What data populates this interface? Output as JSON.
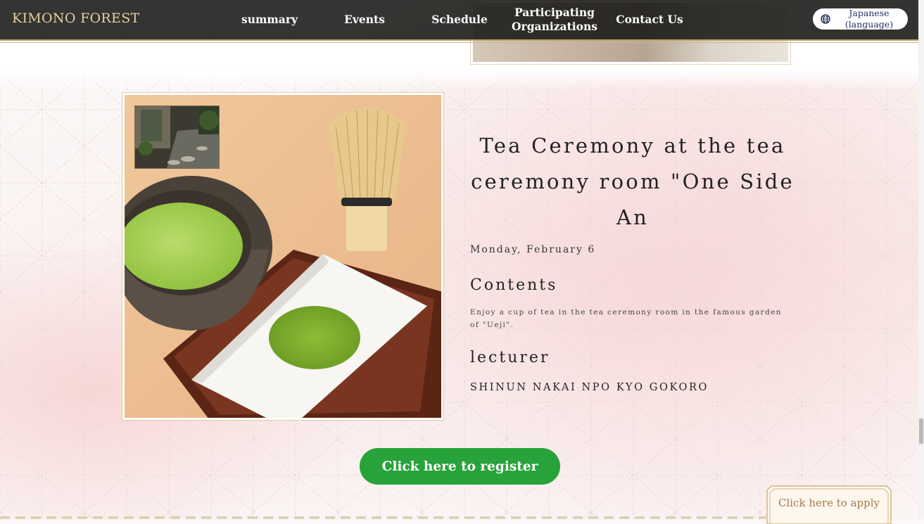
{
  "header": {
    "logo": "KIMONO FOREST",
    "nav": [
      {
        "label": "summary"
      },
      {
        "label": "Events"
      },
      {
        "label": "Schedule"
      },
      {
        "label": "Participating Organizations"
      },
      {
        "label": "Contact Us"
      }
    ],
    "language": {
      "label": "Japanese (language)",
      "icon": "globe-icon"
    }
  },
  "event": {
    "title": "Tea Ceremony at the tea ceremony room \"One Side An",
    "date": "Monday, February 6",
    "contents_heading": "Contents",
    "contents_text": "Enjoy a cup of tea in the tea ceremony room in the famous garden of \"Ueji\".",
    "lecturer_heading": "lecturer",
    "lecturer_name": "SHINUN NAKAI NPO KYO GOKORO"
  },
  "actions": {
    "register": "Click here to register",
    "apply": "Click here to apply"
  },
  "colors": {
    "navbar": "#181816",
    "logo": "#e4cfa0",
    "register": "#28a23a",
    "apply_text": "#a57a4a",
    "frame_border": "#dccaa3"
  }
}
